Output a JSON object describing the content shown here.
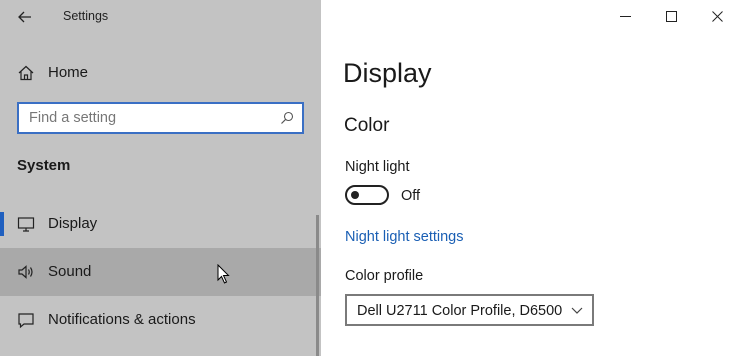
{
  "window": {
    "title": "Settings",
    "controls": [
      "minimize",
      "maximize",
      "close"
    ]
  },
  "sidebar": {
    "home_label": "Home",
    "search": {
      "placeholder": "Find a setting"
    },
    "section_title": "System",
    "items": [
      {
        "label": "Display",
        "icon": "monitor-icon",
        "selected": true
      },
      {
        "label": "Sound",
        "icon": "speaker-icon",
        "hovered": true
      },
      {
        "label": "Notifications & actions",
        "icon": "notification-icon"
      }
    ]
  },
  "main": {
    "page_title": "Display",
    "section_title": "Color",
    "night_light": {
      "label": "Night light",
      "state_label": "Off",
      "toggle_on": false,
      "settings_link": "Night light settings"
    },
    "color_profile": {
      "label": "Color profile",
      "selected_value": "Dell U2711 Color Profile, D6500"
    }
  },
  "colors": {
    "sidebar_bg": "#c3c3c3",
    "accent": "#1f5fbf",
    "link": "#1a5fb4",
    "hover_bg": "#a9a9a9"
  }
}
